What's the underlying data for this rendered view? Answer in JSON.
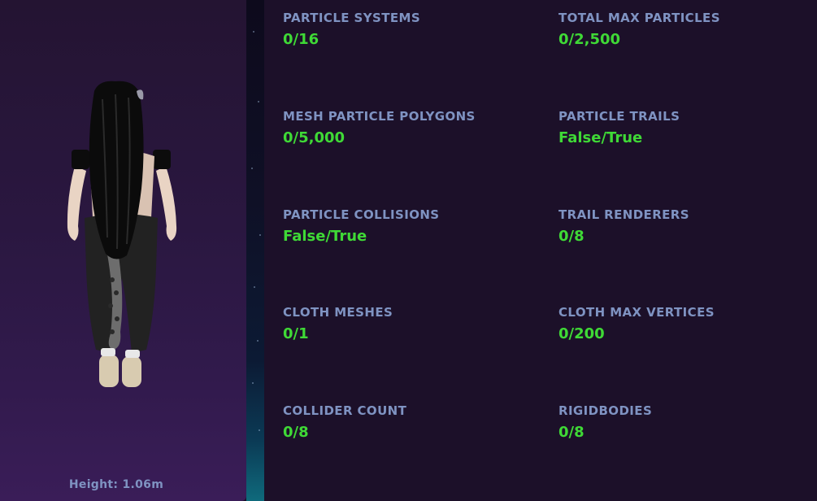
{
  "preview": {
    "height_text": "Height: 1.06m"
  },
  "stats": [
    {
      "label": "PARTICLE SYSTEMS",
      "value": "0/16"
    },
    {
      "label": "TOTAL MAX PARTICLES",
      "value": "0/2,500"
    },
    {
      "label": "MESH PARTICLE POLYGONS",
      "value": "0/5,000"
    },
    {
      "label": "PARTICLE TRAILS",
      "value": "False/True"
    },
    {
      "label": "PARTICLE COLLISIONS",
      "value": "False/True"
    },
    {
      "label": "TRAIL RENDERERS",
      "value": "0/8"
    },
    {
      "label": "CLOTH MESHES",
      "value": "0/1"
    },
    {
      "label": "CLOTH MAX VERTICES",
      "value": "0/200"
    },
    {
      "label": "COLLIDER COUNT",
      "value": "0/8"
    },
    {
      "label": "RIGIDBODIES",
      "value": "0/8"
    }
  ],
  "colors": {
    "label": "#7f93c2",
    "value": "#3fd936",
    "background": "#1c1029"
  }
}
